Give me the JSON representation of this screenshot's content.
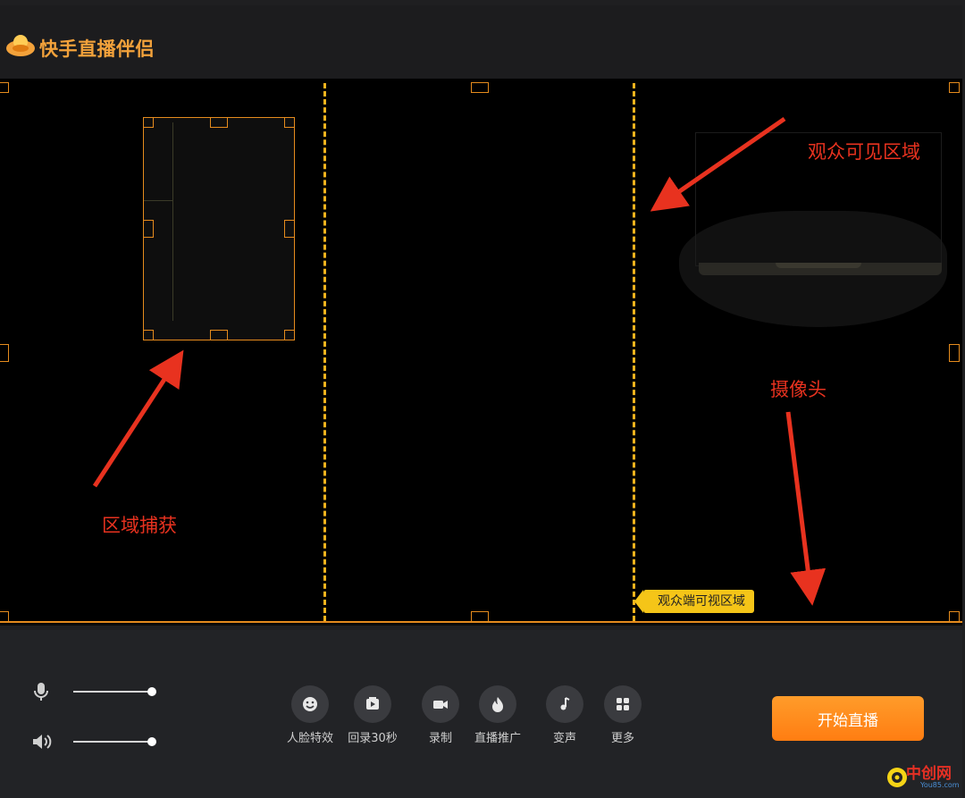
{
  "app": {
    "title": "快手直播伴侣"
  },
  "preview": {
    "viewer_tag": "观众端可视区域",
    "annotations": {
      "region_capture": "区域捕获",
      "viewer_visible": "观众可见区域",
      "camera": "摄像头"
    }
  },
  "toolbar": {
    "tools": [
      {
        "label": "人脸特效",
        "icon": "face-effect-icon"
      },
      {
        "label": "回录30秒",
        "icon": "replay-icon"
      },
      {
        "label": "录制",
        "icon": "record-icon"
      },
      {
        "label": "直播推广",
        "icon": "flame-icon"
      },
      {
        "label": "变声",
        "icon": "voice-change-icon"
      },
      {
        "label": "更多",
        "icon": "grid-icon"
      }
    ],
    "start_label": "开始直播",
    "mic_level": 1.0,
    "speaker_level": 1.0
  },
  "watermark": {
    "text": "中创网",
    "sub": "You85.com"
  },
  "colors": {
    "accent": "#f3a23b",
    "frame": "#e58b1d",
    "dash": "#f2b31d",
    "annotation": "#e8321f",
    "tag": "#f5c518"
  }
}
